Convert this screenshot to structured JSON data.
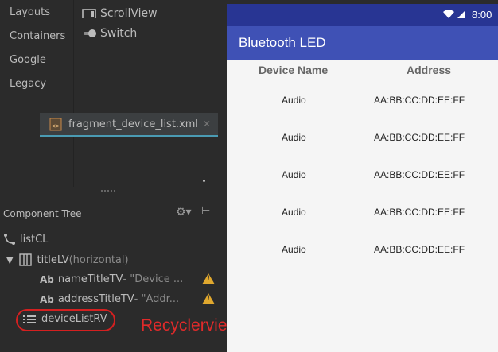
{
  "palette": {
    "categories": [
      "Layouts",
      "Containers",
      "Google",
      "Legacy"
    ],
    "items": [
      {
        "label": "ScrollView",
        "icon": "scrollview-icon"
      },
      {
        "label": "Switch",
        "icon": "switch-icon"
      }
    ]
  },
  "file_tab": {
    "label": "fragment_device_list.xml",
    "close": "✕"
  },
  "component_tree": {
    "title": "Component Tree",
    "nodes": [
      {
        "name": "listCL",
        "detail": "",
        "icon": "constraint-layout-icon"
      },
      {
        "name": "titleLV",
        "detail": "(horizontal)",
        "icon": "linear-layout-icon"
      },
      {
        "name": "nameTitleTV",
        "detail": "- \"Device ...",
        "icon": "textview-icon",
        "warning": true
      },
      {
        "name": "addressTitleTV",
        "detail": "- \"Addr...",
        "icon": "textview-icon",
        "warning": true
      },
      {
        "name": "deviceListRV",
        "detail": "",
        "icon": "list-icon"
      }
    ],
    "textview_glyph": "Ab",
    "annotation": "Recyclerview"
  },
  "device": {
    "status_time": "8:00",
    "app_title": "Bluetooth LED",
    "headers": {
      "name": "Device Name",
      "address": "Address"
    },
    "rows": [
      {
        "name": "Audio",
        "address": "AA:BB:CC:DD:EE:FF"
      },
      {
        "name": "Audio",
        "address": "AA:BB:CC:DD:EE:FF"
      },
      {
        "name": "Audio",
        "address": "AA:BB:CC:DD:EE:FF"
      },
      {
        "name": "Audio",
        "address": "AA:BB:CC:DD:EE:FF"
      },
      {
        "name": "Audio",
        "address": "AA:BB:CC:DD:EE:FF"
      }
    ]
  },
  "colors": {
    "ide_bg": "#2b2b2b",
    "status_bar": "#283593",
    "toolbar": "#3f51b5",
    "warning": "#e0a82e",
    "annotation_red": "#d42020",
    "tab_underline": "#4a9bb3"
  }
}
